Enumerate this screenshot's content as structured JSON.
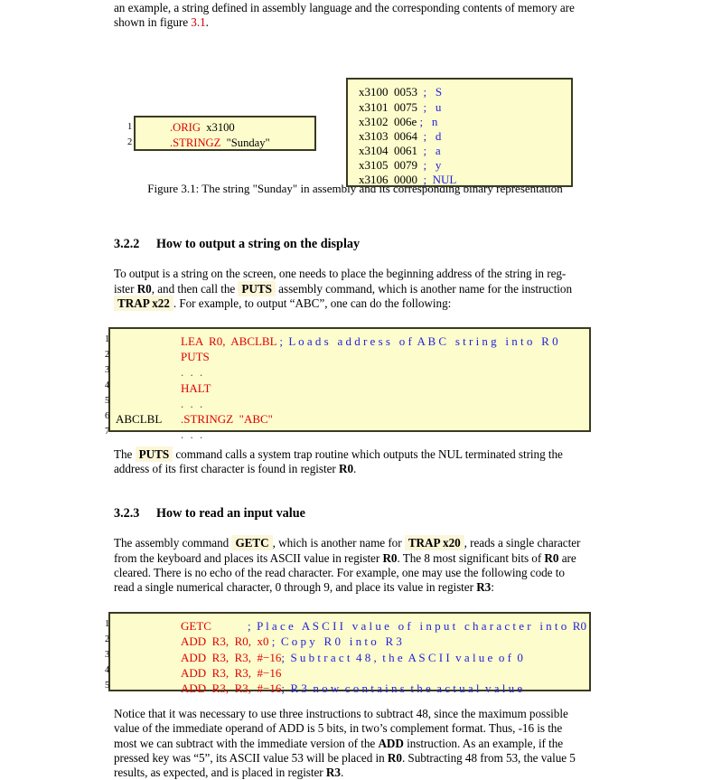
{
  "colors": {
    "code_bg": "#fcfccc",
    "code_border": "#3a3a22",
    "inline_kw_bg": "#fcf6d8",
    "opcode_red": "#e00000",
    "comment_blue": "#2222dd",
    "link_red": "#cf0000",
    "text": "#000000"
  },
  "intro": {
    "line1_a": "an example, a string defined in assembly language and the corresponding contents of memory are",
    "line2_a": "shown in figure ",
    "line2_ref": "3.1",
    "line2_b": "."
  },
  "figure1": {
    "asm_box": {
      "line_numbers": [
        "1",
        "2"
      ],
      "lines": [
        {
          "directive": ".ORIG",
          "operand": "x3100"
        },
        {
          "directive": ".STRINGZ",
          "operand": "\"Sunday\""
        }
      ]
    },
    "memory_box": {
      "rows": [
        {
          "address": "x3100",
          "value": "0053",
          "sep": ";",
          "char": "S"
        },
        {
          "address": "x3101",
          "value": "0075",
          "sep": ";",
          "char": "u"
        },
        {
          "address": "x3102",
          "value": "006e",
          "sep": ";",
          "char": "n"
        },
        {
          "address": "x3103",
          "value": "0064",
          "sep": ";",
          "char": "d"
        },
        {
          "address": "x3104",
          "value": "0061",
          "sep": ";",
          "char": "a"
        },
        {
          "address": "x3105",
          "value": "0079",
          "sep": ";",
          "char": "y"
        },
        {
          "address": "x3106",
          "value": "0000",
          "sep": ";",
          "char": "NUL"
        }
      ]
    },
    "caption": "Figure 3.1: The string \"Sunday\" in assembly and its corresponding binary representation"
  },
  "section_322": {
    "number": "3.2.2",
    "title": "How to output a string on the display",
    "para": {
      "t1": "To output is a string on the screen, one needs to place the beginning address of the string in reg-",
      "t2": "ister ",
      "reg0": "R0",
      "t3": ", and then call the ",
      "kw_puts": "PUTS",
      "t4": " assembly command, which is another name for the instruction",
      "kw_trap22": "TRAP x22",
      "t5": ". For example, to output “ABC”, one can do the following:"
    }
  },
  "listing1": {
    "line_numbers": [
      "1",
      "2",
      "3",
      "4",
      "5",
      "6",
      "7"
    ],
    "rows": [
      {
        "label": "",
        "code": "LEA  R0,  ABCLBL",
        "comment": ";  L o a d s   a d d r e s s   o f  A B C   s t r i n g   i n t o   R 0"
      },
      {
        "label": "",
        "code": "PUTS",
        "comment": ""
      },
      {
        "label": "",
        "code": ". . .",
        "comment": "",
        "is_dots": true
      },
      {
        "label": "",
        "code": "HALT",
        "comment": ""
      },
      {
        "label": "",
        "code": ". . .",
        "comment": "",
        "is_dots": true
      },
      {
        "label": "ABCLBL",
        "code": ".STRINGZ  \"ABC\"",
        "comment": ""
      },
      {
        "label": "",
        "code": ". . .",
        "comment": "",
        "is_dots": true
      }
    ]
  },
  "after_listing1": {
    "t1": "The ",
    "kw_puts": "PUTS",
    "t2": " command calls a system trap routine which outputs the NUL terminated string the",
    "t3": "address of its first character is found in register ",
    "reg0": "R0",
    "t4": "."
  },
  "section_323": {
    "number": "3.2.3",
    "title": "How to read an input value",
    "para": {
      "t1": "The assembly command ",
      "kw_getc": "GETC",
      "t2": ", which is another name for ",
      "kw_trap20": "TRAP x20",
      "t3": ", reads a single character",
      "t4": "from the keyboard and places its ASCII value in register ",
      "reg0a": "R0",
      "t5": ". The 8 most significant bits of ",
      "reg0b": "R0",
      "t6": " are",
      "t7": "cleared.  There is no echo of the read character.  For example, one may use the following code to",
      "t8": "read a single numerical character, 0 through 9, and place its value in register ",
      "reg3": "R3",
      "t9": ":"
    }
  },
  "listing2": {
    "line_numbers": [
      "1",
      "2",
      "3",
      "4",
      "5"
    ],
    "rows": [
      {
        "code": "GETC",
        "comment": ";  P l a c e   A S C I I   v a l u e   o f   i n p u t   c h a r a c t e r   i n t o  R0"
      },
      {
        "code": "ADD  R3,  R0,  x0",
        "comment": ";  C o p y   R 0   i n t o   R 3"
      },
      {
        "code": "ADD  R3,  R3,  #−16",
        "comment": ";  S u b t r a c t  4 8 ,  t h e  A S C I I  v a l u e  o f  0"
      },
      {
        "code": "ADD  R3,  R3,  #−16",
        "comment": ""
      },
      {
        "code": "ADD  R3,  R3,  #−16",
        "comment": ";  R 3  n o w  c o n t a i n s  t h e  a c t u a l  v a l u e"
      }
    ]
  },
  "closing": {
    "t1": "Notice that it was necessary to use three instructions to subtract 48, since the maximum possible",
    "t2": "value of the immediate operand of ADD is 5 bits, in two’s complement format.  Thus, ",
    "neg16": "-16",
    "t3": " is the",
    "t4": "most we can subtract with the immediate version of the ",
    "add": "ADD",
    "t5": " instruction.  As an example, if the",
    "t6": "pressed key was “5”, its ASCII value 53 will be placed in ",
    "reg0": "R0",
    "t7": ". Subtracting 48 from 53, the value 5",
    "t8": "results, as expected, and is placed in register ",
    "reg3": "R3",
    "t9": "."
  }
}
